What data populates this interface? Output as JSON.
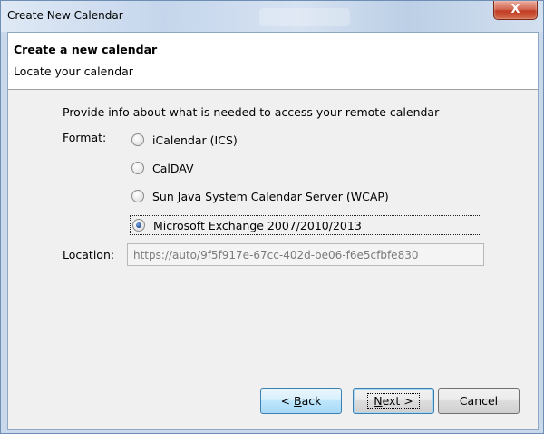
{
  "window": {
    "title": "Create New Calendar",
    "close_glyph": "X"
  },
  "header": {
    "title": "Create a new calendar",
    "subtitle": "Locate your calendar"
  },
  "form": {
    "intro": "Provide info about what is needed to access your remote calendar",
    "format_label": "Format:",
    "options": [
      {
        "label": "iCalendar (ICS)",
        "selected": false
      },
      {
        "label": "CalDAV",
        "selected": false
      },
      {
        "label": "Sun Java System Calendar Server (WCAP)",
        "selected": false
      },
      {
        "label": "Microsoft Exchange 2007/2010/2013",
        "selected": true
      }
    ],
    "location_label": "Location:",
    "location_value": "https://auto/9f5f917e-67cc-402d-be06-f6e5cfbfe830"
  },
  "buttons": {
    "back": {
      "prefix": "< ",
      "accel": "B",
      "rest": "ack"
    },
    "next": {
      "accel": "N",
      "rest": "ext >"
    },
    "cancel": "Cancel"
  }
}
